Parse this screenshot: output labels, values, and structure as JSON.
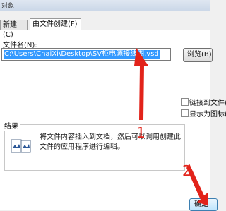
{
  "window": {
    "title": "对象"
  },
  "tabs": [
    {
      "label": "新建(C)"
    },
    {
      "label": "由文件创建(F)"
    }
  ],
  "file_field": {
    "label": "文件名(N):",
    "value": "C:\\Users\\ChaiXi\\Desktop\\SV柜电源接线图.vsd"
  },
  "browse_button": {
    "label": "浏览(B)..."
  },
  "checkboxes": [
    {
      "label": "链接到文件(K)",
      "checked": false
    },
    {
      "label": "显示为图标(A)",
      "checked": false
    }
  ],
  "result": {
    "title": "结果",
    "text": "将文件内容插入到文档，然后可以调用创建此文件的应用程序进行编辑。"
  },
  "ok_button": {
    "label": "确定"
  },
  "annotations": [
    {
      "number": "1",
      "color": "#e2231a"
    },
    {
      "number": "2",
      "color": "#e2231a"
    }
  ]
}
